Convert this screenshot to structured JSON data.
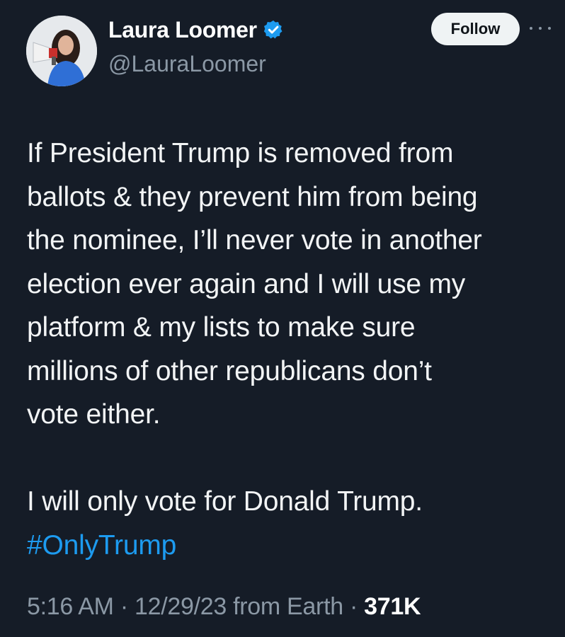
{
  "author": {
    "display_name": "Laura Loomer",
    "handle": "@LauraLoomer",
    "verified_icon": "verified-badge-icon",
    "avatar_icon": "avatar-photo-with-megaphone"
  },
  "actions": {
    "follow_label": "Follow",
    "more_icon": "more-options-icon"
  },
  "tweet": {
    "lines": [
      "If President Trump is removed from",
      "ballots & they prevent him from being",
      "the nominee, I’ll never vote in another",
      "election ever again and I will use my",
      "platform & my lists to make sure",
      "millions of other republicans don’t",
      "vote either.",
      "",
      "I will only vote for Donald Trump."
    ],
    "hashtag": "#OnlyTrump"
  },
  "meta": {
    "time": "5:16 AM",
    "separator": "·",
    "date": "12/29/23",
    "source": "from Earth",
    "views": "371K"
  },
  "colors": {
    "background": "#151c27",
    "accent": "#1d9bf0",
    "muted_text": "#8b98a5",
    "follow_button_bg": "#eff3f4"
  }
}
